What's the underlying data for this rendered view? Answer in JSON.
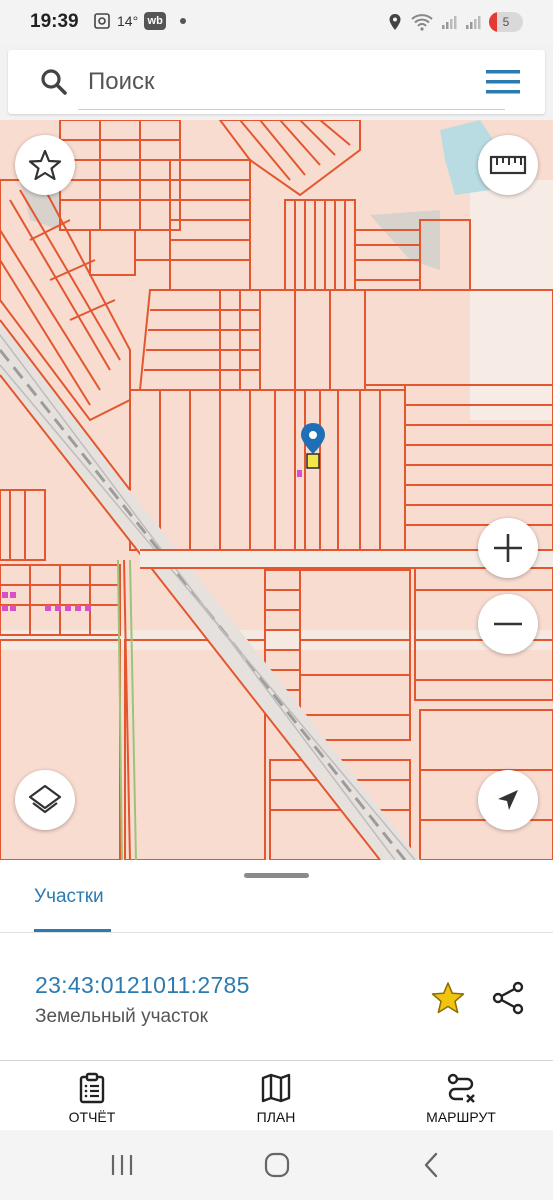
{
  "status_bar": {
    "time": "19:39",
    "temperature": "14°",
    "app_badge": "wb",
    "battery": "5"
  },
  "search": {
    "placeholder": "Поиск"
  },
  "sheet": {
    "tab_label": "Участки",
    "parcel": {
      "cadastral_number": "23:43:0121011:2785",
      "type": "Земельный участок"
    }
  },
  "bottom_nav": [
    {
      "label": "ОТЧЁТ",
      "icon": "report-icon"
    },
    {
      "label": "ПЛАН",
      "icon": "map-icon"
    },
    {
      "label": "МАРШРУТ",
      "icon": "route-icon"
    }
  ],
  "colors": {
    "accent": "#2b7bb0",
    "map_background": "#f9dcd0",
    "parcel_border": "#e2572f",
    "road": "#cfcfcf",
    "water": "#b9dce3",
    "pin": "#1e6fb5",
    "favorite": "#f1c40f"
  }
}
